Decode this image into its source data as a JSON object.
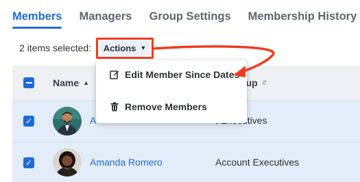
{
  "tabs": [
    {
      "label": "Members",
      "active": true
    },
    {
      "label": "Managers",
      "active": false
    },
    {
      "label": "Group Settings",
      "active": false
    },
    {
      "label": "Membership History",
      "active": false
    }
  ],
  "selection": {
    "count_text": "2 items selected:",
    "actions_label": "Actions",
    "actions_icon": "chevron-down-icon"
  },
  "table": {
    "columns": [
      {
        "label": "Name",
        "sort_icon": "sort-asc-icon"
      },
      {
        "label": "Board Group",
        "sort_icon": "sort-icon",
        "visible_label": "ard Group"
      }
    ],
    "header_checkbox": "indeterminate",
    "rows": [
      {
        "name": "A",
        "group": "Account Executives",
        "group_visible": "t Executives",
        "selected": true
      },
      {
        "name": "Amanda Romero",
        "group": "Account Executives",
        "selected": true
      }
    ]
  },
  "menu": {
    "items": [
      {
        "label": "Edit Member Since Dates",
        "icon": "edit-icon"
      },
      {
        "label": "Remove Members",
        "icon": "trash-icon"
      }
    ]
  },
  "colors": {
    "accent": "#1f6bd6",
    "annotation": "#f03b20",
    "selected_row": "#e3edf9",
    "header_bg": "#eef0f3"
  }
}
